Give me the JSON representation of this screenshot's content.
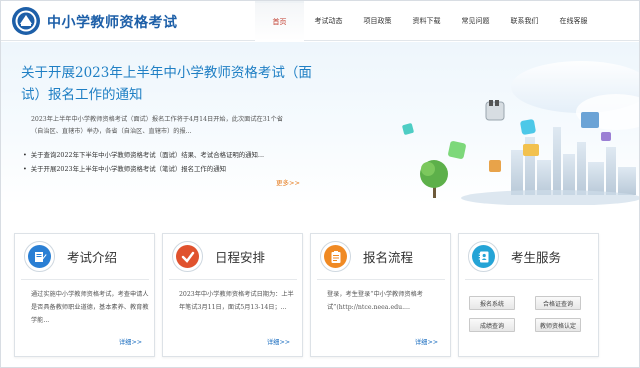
{
  "header": {
    "site_title": "中小学教师资格考试",
    "nav": [
      {
        "label": "首页",
        "active": true
      },
      {
        "label": "考试动态",
        "active": false
      },
      {
        "label": "项目政策",
        "active": false
      },
      {
        "label": "资料下载",
        "active": false
      },
      {
        "label": "常见问题",
        "active": false
      },
      {
        "label": "联系我们",
        "active": false
      },
      {
        "label": "在线客服",
        "active": false
      }
    ]
  },
  "banner": {
    "title": "关于开展2023年上半年中小学教师资格考试（面试）报名工作的通知",
    "summary": "2023年上半年中小学教师资格考试（面试）报名工作将于4月14日开始，此次面试在31个省（自治区、直辖市）举办，各省（自治区、直辖市）的报...",
    "news": [
      "关于查询2022年下半年中小学教师资格考试（面试）结果、考试合格证明的通知...",
      "关于开展2023年上半年中小学教师资格考试（笔试）报名工作的通知"
    ],
    "more": "更多>>"
  },
  "cards": [
    {
      "title": "考试介绍",
      "text": "通过实施中小学教师资格考试，考查申请人是否具备教师职业道德，基本素养、教育教学能...",
      "more": "详细>>",
      "icon": "document-edit-icon",
      "color": "#2a7fd4"
    },
    {
      "title": "日程安排",
      "text": "2023年中小学教师资格考试日期为：上半年笔试3月11日，面试5月13-14日；...",
      "more": "详细>>",
      "icon": "checkmark-icon",
      "color": "#e0522e"
    },
    {
      "title": "报名流程",
      "text": "登录，考生登录“中小学教师资格考试”(http://ntce.neea.edu....",
      "more": "详细>>",
      "icon": "clipboard-list-icon",
      "color": "#f08a24"
    },
    {
      "title": "考生服务",
      "icon": "contact-card-icon",
      "color": "#25a4d6"
    }
  ],
  "services": [
    "报名系统",
    "合格证查询",
    "成绩查询",
    "教师资格认定"
  ]
}
